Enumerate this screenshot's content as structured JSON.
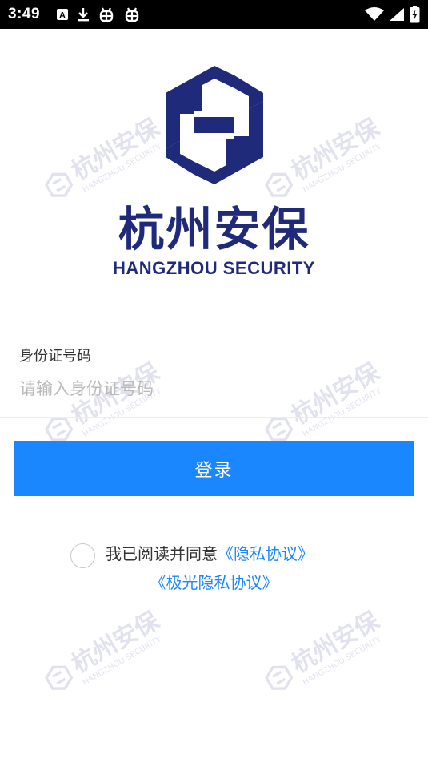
{
  "status_bar": {
    "time": "3:49",
    "icons": [
      "font-a-icon",
      "download-icon",
      "bug-icon",
      "bug-icon",
      "wifi-icon",
      "signal-icon",
      "battery-charging-icon"
    ]
  },
  "brand": {
    "name_cn": "杭州安保",
    "name_en": "HANGZHOU SECURITY",
    "color": "#1f2a7a"
  },
  "watermark": {
    "name_cn": "杭州安保",
    "name_en": "HANGZHOU SECURITY"
  },
  "form": {
    "id_label": "身份证号码",
    "id_placeholder": "请输入身份证号码",
    "id_value": ""
  },
  "login_button": {
    "label": "登录",
    "color": "#1a86ff"
  },
  "agreement": {
    "checked": false,
    "prefix": "我已阅读并同意",
    "privacy_link": "《隐私协议》",
    "jiguang_link": "《极光隐私协议》",
    "link_color": "#1a86ff"
  }
}
